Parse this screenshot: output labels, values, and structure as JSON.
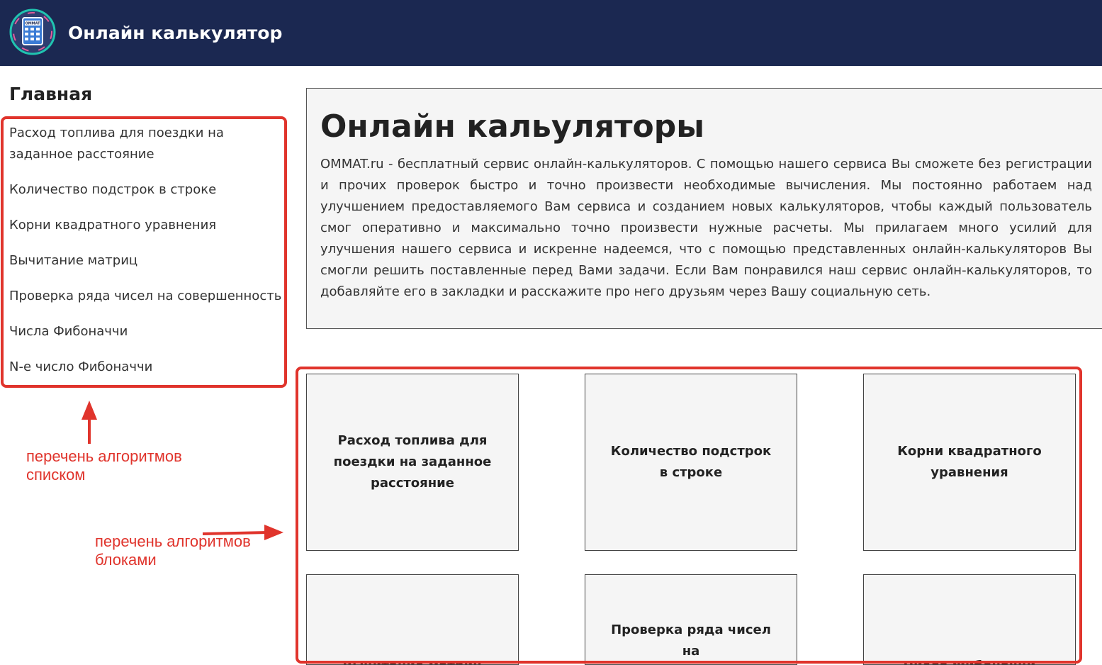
{
  "header": {
    "logo_text": "OMMAT",
    "title": "Онлайн калькулятор",
    "background": "#1b2851"
  },
  "sidebar": {
    "heading": "Главная",
    "items": [
      {
        "label": "Расход топлива для поездки на заданное расстояние"
      },
      {
        "label": "Количество подстрок в строке"
      },
      {
        "label": "Корни квадратного уравнения"
      },
      {
        "label": "Вычитание матриц"
      },
      {
        "label": "Проверка ряда чисел на совершенность"
      },
      {
        "label": "Числа Фибоначчи"
      },
      {
        "label": "N-е число Фибоначчи"
      }
    ]
  },
  "main": {
    "title": "Онлайн кальуляторы",
    "intro": "OMMAT.ru - бесплатный сервис онлайн-калькуляторов. С помощью нашего сервиса Вы сможете без регистрации и прочих проверок быстро и точно произвести необходимые вычисления. Мы постоянно работаем над улучшением предоставляемого Вам сервиса и созданием новых калькуляторов, чтобы каждый пользователь смог оперативно и максимально точно произвести нужные расчеты. Мы прилагаем много усилий для улучшения нашего сервиса и искренне надеемся, что с помощью представленных онлайн-калькуляторов Вы смогли решить поставленные перед Вами задачи. Если Вам понравился наш сервис онлайн-калькуляторов, то добавляйте его в закладки и расскажите про него друзьям через Вашу социальную сеть.",
    "cards": [
      {
        "label": "Расход топлива для поездки на заданное расстояние"
      },
      {
        "label": "Количество подстрок в строке"
      },
      {
        "label": "Корни квадратного уравнения"
      },
      {
        "label": "Вычитание матриц"
      },
      {
        "label": "Проверка ряда чисел на"
      },
      {
        "label": "Числа Фибоначчи"
      }
    ]
  },
  "annotations": {
    "list_note": "перечень алгоритмов списком",
    "blocks_note": "перечень алгоритмов блоками",
    "color": "#e0342c"
  }
}
